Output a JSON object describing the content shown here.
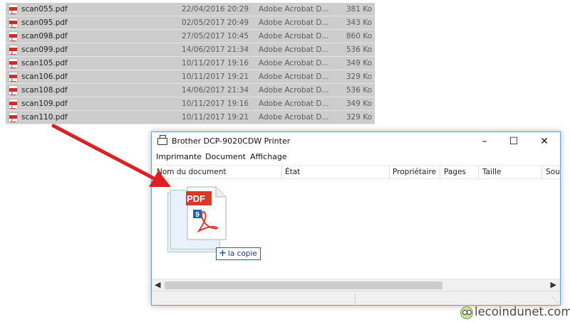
{
  "files": [
    {
      "name": "scan055.pdf",
      "date": "22/04/2016 20:29",
      "type": "Adobe Acrobat D...",
      "size": "381 Ko"
    },
    {
      "name": "scan095.pdf",
      "date": "02/05/2017 20:49",
      "type": "Adobe Acrobat D...",
      "size": "343 Ko"
    },
    {
      "name": "scan098.pdf",
      "date": "27/05/2017 10:45",
      "type": "Adobe Acrobat D...",
      "size": "860 Ko"
    },
    {
      "name": "scan099.pdf",
      "date": "14/06/2017 21:34",
      "type": "Adobe Acrobat D...",
      "size": "536 Ko"
    },
    {
      "name": "scan105.pdf",
      "date": "10/11/2017 19:16",
      "type": "Adobe Acrobat D...",
      "size": "349 Ko"
    },
    {
      "name": "scan106.pdf",
      "date": "10/11/2017 19:21",
      "type": "Adobe Acrobat D...",
      "size": "329 Ko"
    },
    {
      "name": "scan108.pdf",
      "date": "14/06/2017 21:34",
      "type": "Adobe Acrobat D...",
      "size": "536 Ko"
    },
    {
      "name": "scan109.pdf",
      "date": "10/11/2017 19:16",
      "type": "Adobe Acrobat D...",
      "size": "349 Ko"
    },
    {
      "name": "scan110.pdf",
      "date": "10/11/2017 19:21",
      "type": "Adobe Acrobat D...",
      "size": "329 Ko"
    }
  ],
  "printer_window": {
    "title": "Brother DCP-9020CDW Printer",
    "controls": {
      "minimize": "–",
      "maximize": "☐",
      "close": "✕"
    },
    "menu": {
      "printer": "Imprimante",
      "document": "Document",
      "view": "Affichage"
    },
    "columns": {
      "document_name": "Nom du document",
      "status": "État",
      "owner": "Propriétaire",
      "pages": "Pages",
      "size": "Taille",
      "submitted": "Sou"
    }
  },
  "drag": {
    "pdf_label": "PDF",
    "file_count": "9",
    "drop_plus": "+",
    "drop_text": "la copie"
  },
  "watermark": {
    "text": "lecoindunet.com"
  },
  "colors": {
    "arrow": "#e02020",
    "pdf_red": "#d9392b",
    "selection": "#cdcdcd",
    "window_border": "#6f9bd1"
  },
  "icons": {
    "file": "pdf-file-icon",
    "printer": "printer-icon",
    "drag": "pdf-document-icon"
  }
}
